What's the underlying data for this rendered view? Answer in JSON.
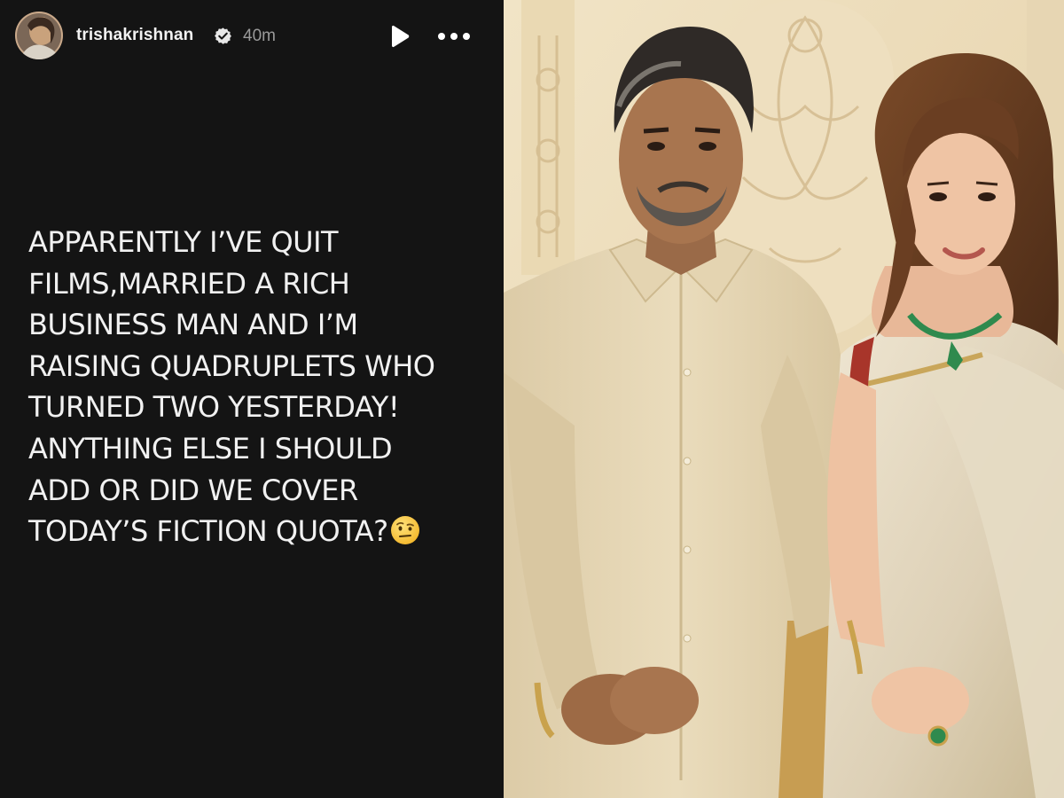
{
  "story": {
    "username": "trishakrishnan",
    "time": "40m",
    "icons": {
      "verified": "verified-badge-icon",
      "play": "play-icon",
      "more": "more-options-icon",
      "emoji": "face-with-raised-eyebrow-emoji"
    },
    "text_lines": [
      "APPARENTLY I’VE QUIT",
      "FILMS,MARRIED A RICH",
      "BUSINESS MAN AND I’M",
      "RAISING QUADRUPLETS WHO",
      "TURNED TWO YESTERDAY!",
      "ANYTHING ELSE I SHOULD",
      "ADD OR DID WE COVER",
      "TODAY’S FICTION QUOTA?"
    ],
    "colors": {
      "background": "#141414",
      "text": "#f1f1f1",
      "meta": "#9a9a9a"
    }
  }
}
